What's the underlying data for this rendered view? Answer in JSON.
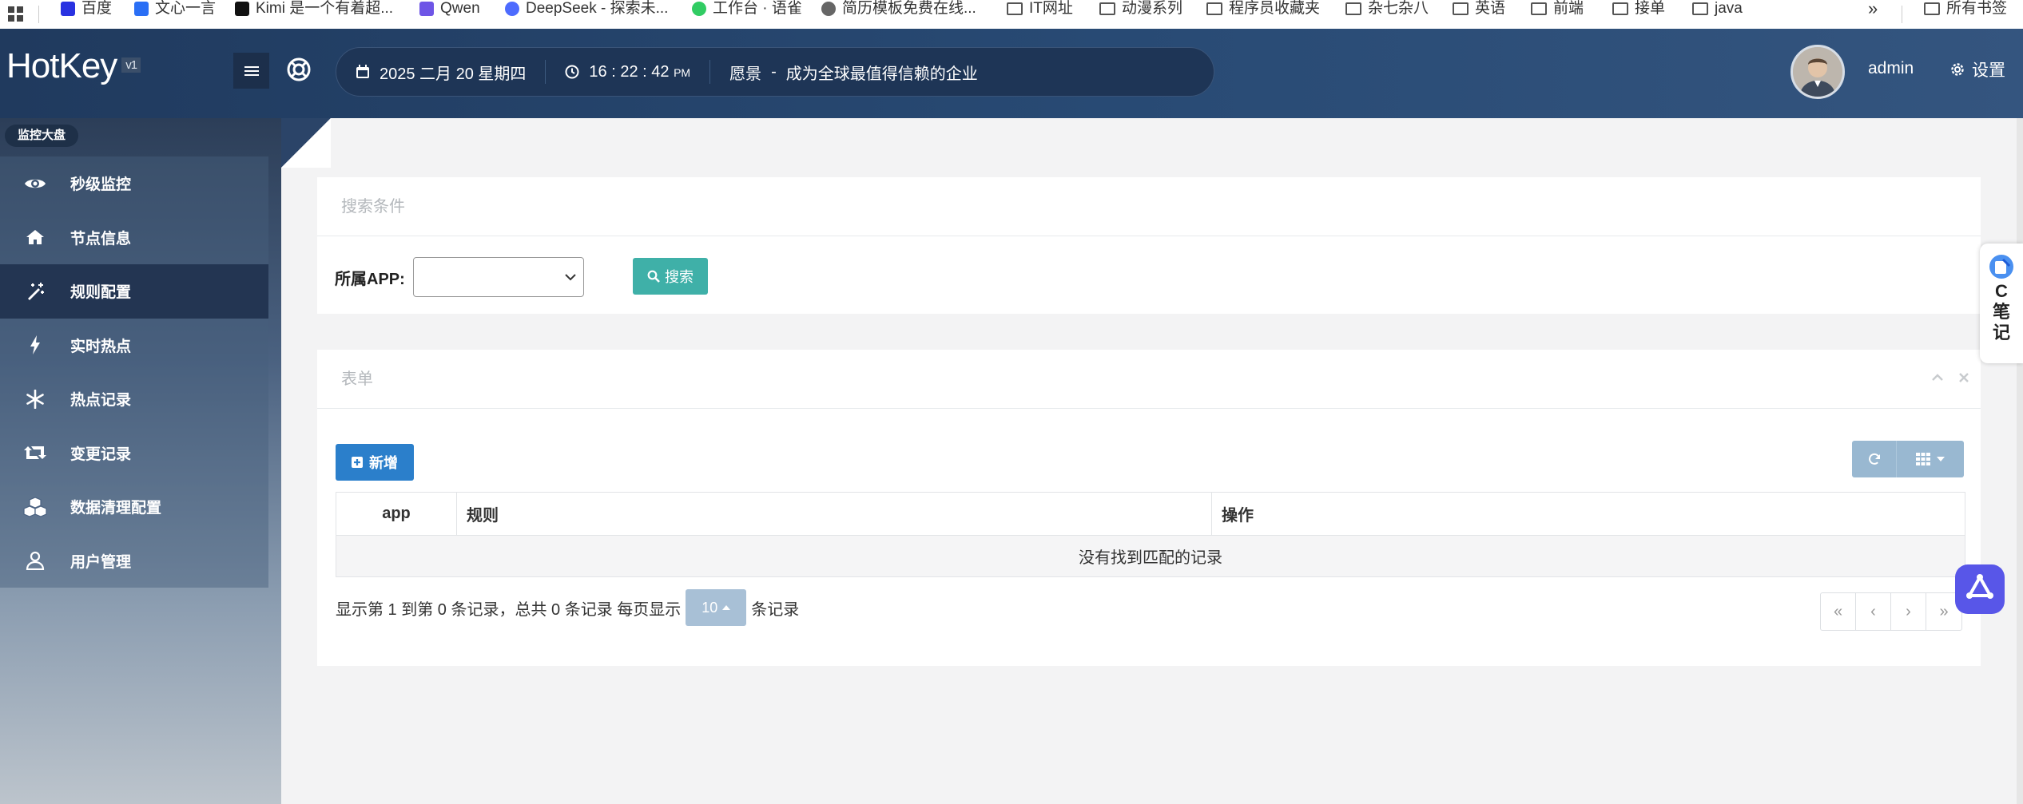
{
  "bookmarks": {
    "items": [
      "百度",
      "文心一言",
      "Kimi 是一个有着超...",
      "Qwen",
      "DeepSeek - 探索未...",
      "工作台 · 语雀",
      "简历模板免费在线..."
    ],
    "folders": [
      "IT网址",
      "动漫系列",
      "程序员收藏夹",
      "杂七杂八",
      "英语",
      "前端",
      "接单",
      "java"
    ],
    "more": "»",
    "all_bookmarks": "所有书签"
  },
  "header": {
    "logo": "HotKey",
    "version": "v1",
    "date": "2025 二月 20 星期四",
    "time": "16 : 22 : 42",
    "ampm": "PM",
    "vision_label": "愿景",
    "vision_sep": "-",
    "vision_text": "成为全球最值得信赖的企业",
    "username": "admin",
    "settings_label": "设置"
  },
  "sidebar": {
    "section_label": "监控大盘",
    "items": [
      {
        "label": "秒级监控",
        "icon": "eye-icon"
      },
      {
        "label": "节点信息",
        "icon": "home-icon"
      },
      {
        "label": "规则配置",
        "icon": "magic-wand-icon",
        "active": true
      },
      {
        "label": "实时热点",
        "icon": "bolt-icon"
      },
      {
        "label": "热点记录",
        "icon": "snowflake-icon"
      },
      {
        "label": "变更记录",
        "icon": "retweet-icon"
      },
      {
        "label": "数据清理配置",
        "icon": "cubes-icon"
      },
      {
        "label": "用户管理",
        "icon": "user-icon"
      }
    ]
  },
  "search_panel": {
    "title": "搜索条件",
    "app_label": "所属APP:",
    "app_value": "",
    "search_label": "搜索"
  },
  "table_panel": {
    "title": "表单",
    "add_label": "新增",
    "columns": [
      "app",
      "规则",
      "操作"
    ],
    "empty_text": "没有找到匹配的记录",
    "pager_prefix": "显示第 1 到第 0 条记录，总共 0 条记录 每页显示",
    "page_size": "10",
    "pager_suffix": "条记录",
    "pages": [
      "«",
      "‹",
      "›",
      "»"
    ]
  },
  "widgets": {
    "cnote": [
      "C",
      "笔",
      "记"
    ]
  },
  "colors": {
    "header_bg": "#284a74",
    "sidebar_active": "#233552",
    "search_btn": "#3fb0a8",
    "add_btn": "#2b7fcb",
    "ai_btn": "#5856e8"
  }
}
